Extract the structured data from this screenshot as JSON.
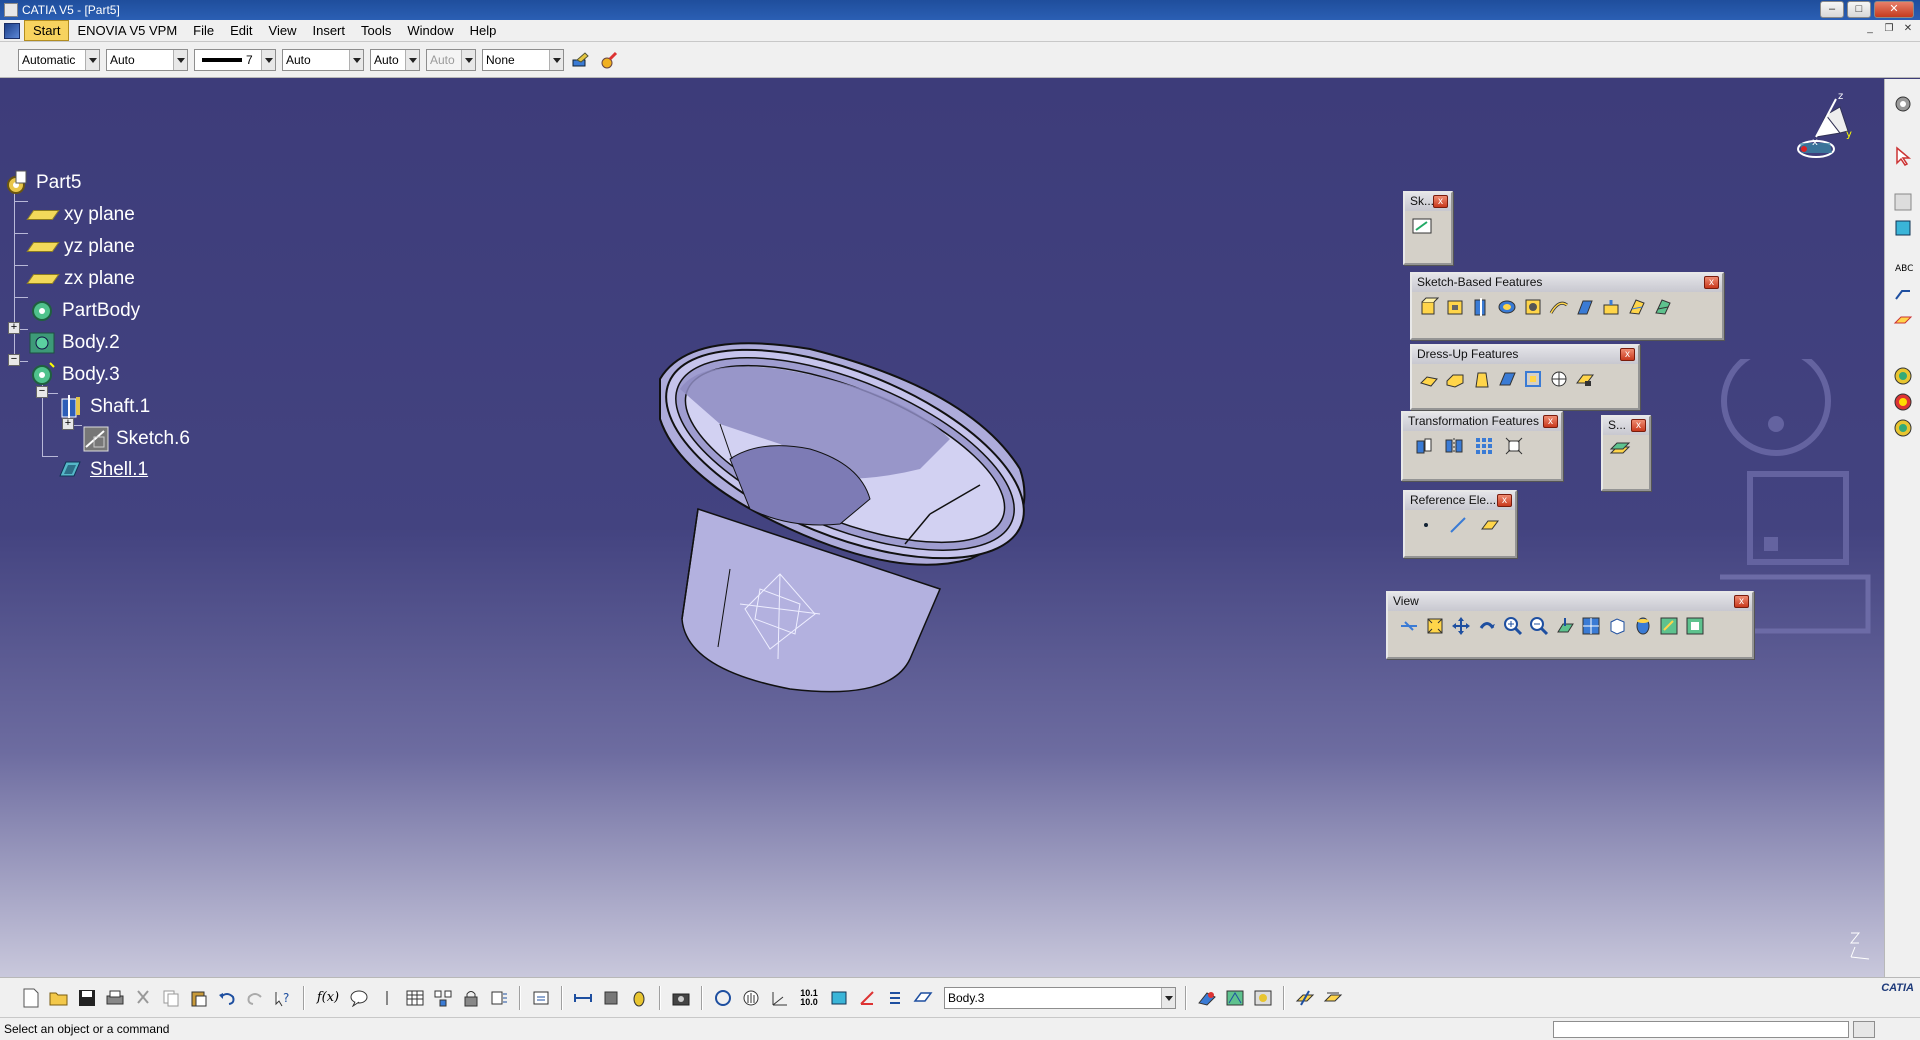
{
  "window": {
    "title": "CATIA V5 - [Part5]"
  },
  "menu": {
    "items": [
      "Start",
      "ENOVIA V5 VPM",
      "File",
      "Edit",
      "View",
      "Insert",
      "Tools",
      "Window",
      "Help"
    ]
  },
  "graphic_properties": {
    "color": "Automatic",
    "transparency": "Auto",
    "line_weight": "7",
    "line_type": "Auto",
    "point_type": "Auto",
    "layer_disabled": "Auto",
    "layer": "None"
  },
  "tree": {
    "root": "Part5",
    "items": [
      {
        "label": "xy plane"
      },
      {
        "label": "yz plane"
      },
      {
        "label": "zx plane"
      },
      {
        "label": "PartBody"
      },
      {
        "label": "Body.2"
      },
      {
        "label": "Body.3"
      },
      {
        "label": "Shaft.1"
      },
      {
        "label": "Sketch.6"
      },
      {
        "label": "Shell.1"
      }
    ]
  },
  "panels": {
    "sketcher": {
      "title": "Sk..."
    },
    "sketch_based": {
      "title": "Sketch-Based Features"
    },
    "dress_up": {
      "title": "Dress-Up Features"
    },
    "transformation": {
      "title": "Transformation Features"
    },
    "surface": {
      "title": "S..."
    },
    "reference": {
      "title": "Reference Ele..."
    },
    "view": {
      "title": "View"
    }
  },
  "compass_axes": {
    "x": "x",
    "y": "y",
    "z": "z"
  },
  "bottom": {
    "current_body": "Body.3",
    "fog_label": "f(x)",
    "zoom_value": "10.1\n10.0",
    "brand": "CATIA"
  },
  "status": {
    "message": "Select an object or a command"
  },
  "colors": {
    "background_top": "#3d3c7a",
    "model_face": "#b8b6e2",
    "highlight": "#f7d35f"
  }
}
